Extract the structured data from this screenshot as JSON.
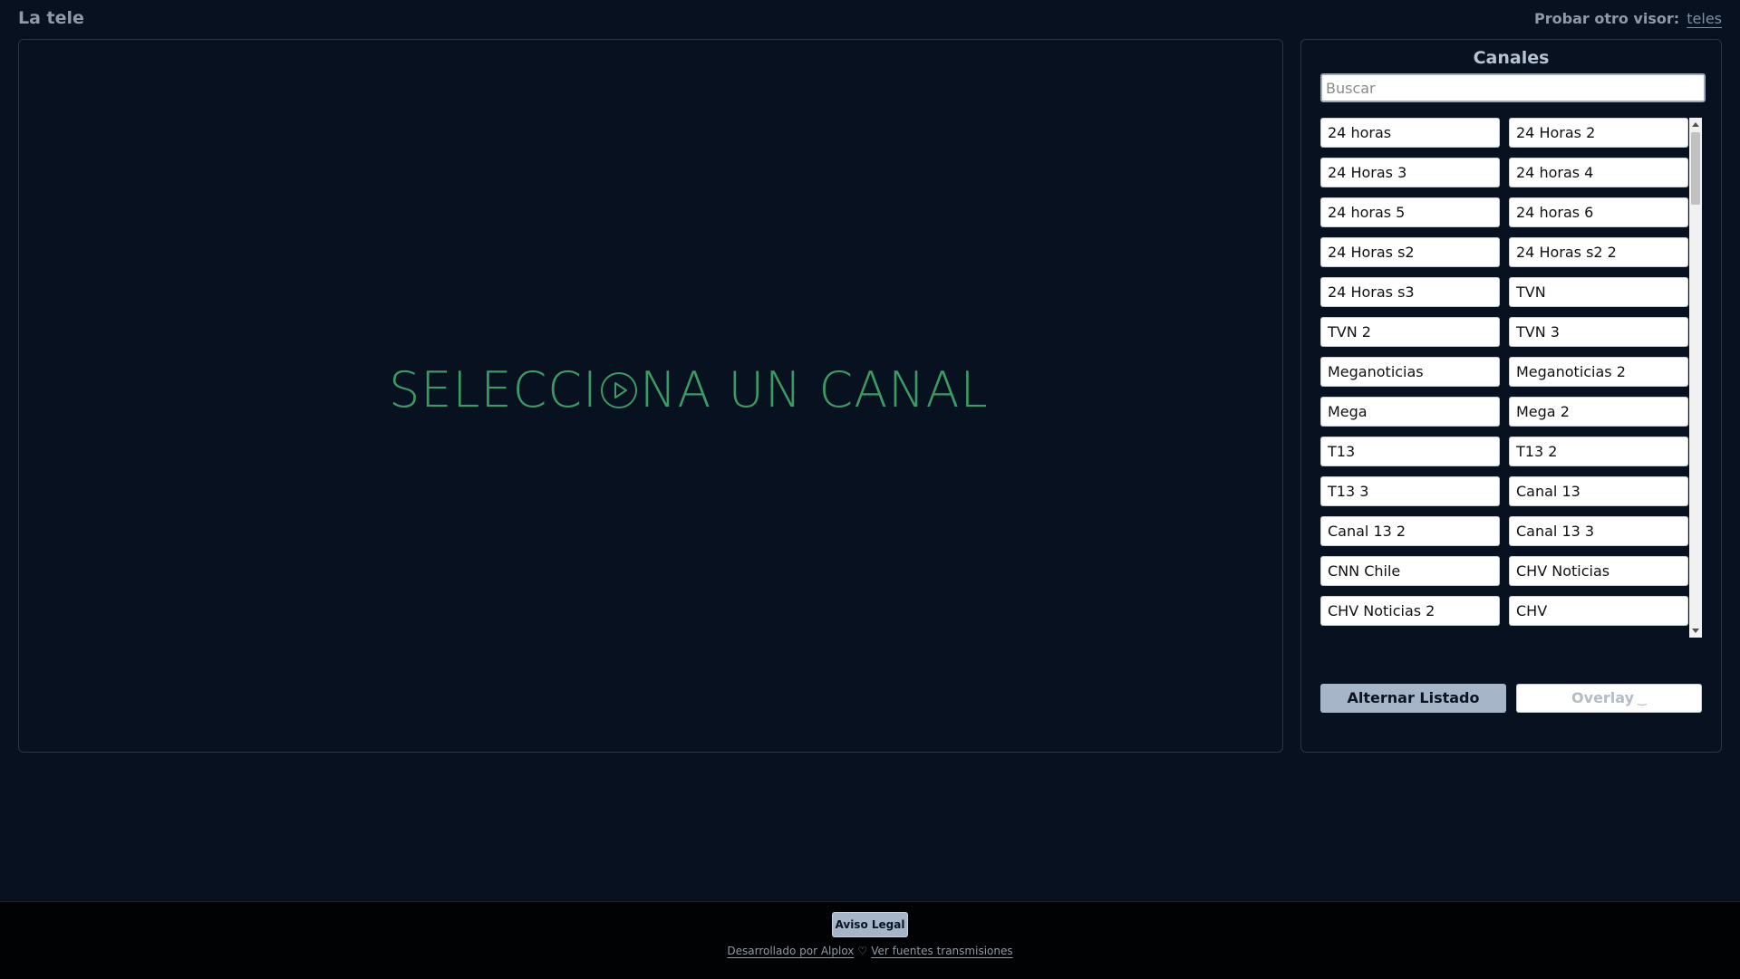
{
  "header": {
    "app_title": "La tele",
    "other_viewer_label": "Probar otro visor:",
    "other_viewer_link": "teles"
  },
  "player": {
    "message_before": "SELECCI",
    "message_after": "NA UN CANAL"
  },
  "channels": {
    "title": "Canales",
    "search_placeholder": "Buscar",
    "items": [
      {
        "label": "24 horas"
      },
      {
        "label": "24 Horas 2"
      },
      {
        "label": "24 Horas 3"
      },
      {
        "label": "24 horas 4"
      },
      {
        "label": "24 horas 5"
      },
      {
        "label": "24 horas 6"
      },
      {
        "label": "24 Horas s2"
      },
      {
        "label": "24 Horas s2 2"
      },
      {
        "label": "24 Horas s3"
      },
      {
        "label": "TVN"
      },
      {
        "label": "TVN 2"
      },
      {
        "label": "TVN 3"
      },
      {
        "label": "Meganoticias"
      },
      {
        "label": "Meganoticias 2"
      },
      {
        "label": "Mega"
      },
      {
        "label": "Mega 2"
      },
      {
        "label": "T13"
      },
      {
        "label": "T13 2"
      },
      {
        "label": "T13 3"
      },
      {
        "label": "Canal 13"
      },
      {
        "label": "Canal 13 2"
      },
      {
        "label": "Canal 13 3"
      },
      {
        "label": "CNN Chile"
      },
      {
        "label": "CHV Noticias"
      },
      {
        "label": "CHV Noticias 2"
      },
      {
        "label": "CHV"
      }
    ],
    "toggle_list_label": "Alternar Listado",
    "overlay_label": "Overlay"
  },
  "footer": {
    "legal_label": "Aviso Legal",
    "developed_by": "Desarrollado por Alplox",
    "sources_link": "Ver fuentes transmisiones"
  },
  "colors": {
    "background": "#071120",
    "accent_green": "#3c9a63",
    "button_blue": "#a6b6c8"
  }
}
